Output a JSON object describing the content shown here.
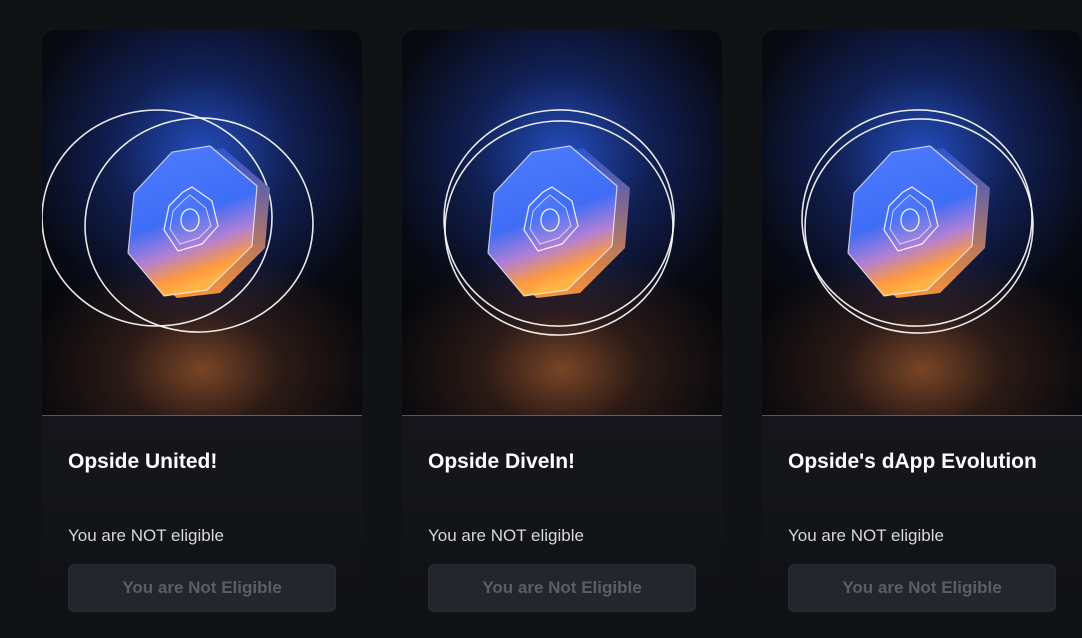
{
  "cards": [
    {
      "title": "Opside United!",
      "status": "You are NOT eligible",
      "button_label": "You are Not Eligible",
      "badge_icon": "hexagon-star-badge-icon"
    },
    {
      "title": "Opside DiveIn!",
      "status": "You are NOT eligible",
      "button_label": "You are Not Eligible",
      "badge_icon": "hexagon-star-badge-icon"
    },
    {
      "title": "Opside's dApp Evolution",
      "status": "You are NOT eligible",
      "button_label": "You are Not Eligible",
      "badge_icon": "hexagon-star-badge-icon"
    }
  ],
  "colors": {
    "page_background": "#111216",
    "card_background": "#0c0d10",
    "button_background": "#24262d",
    "button_text": "#5b5e68",
    "title_text": "#ffffff",
    "status_text": "#d6d8de",
    "badge_blue": "#3f6df5",
    "badge_orange": "#ff9a3d",
    "divider_purple": "#a35bd8"
  }
}
